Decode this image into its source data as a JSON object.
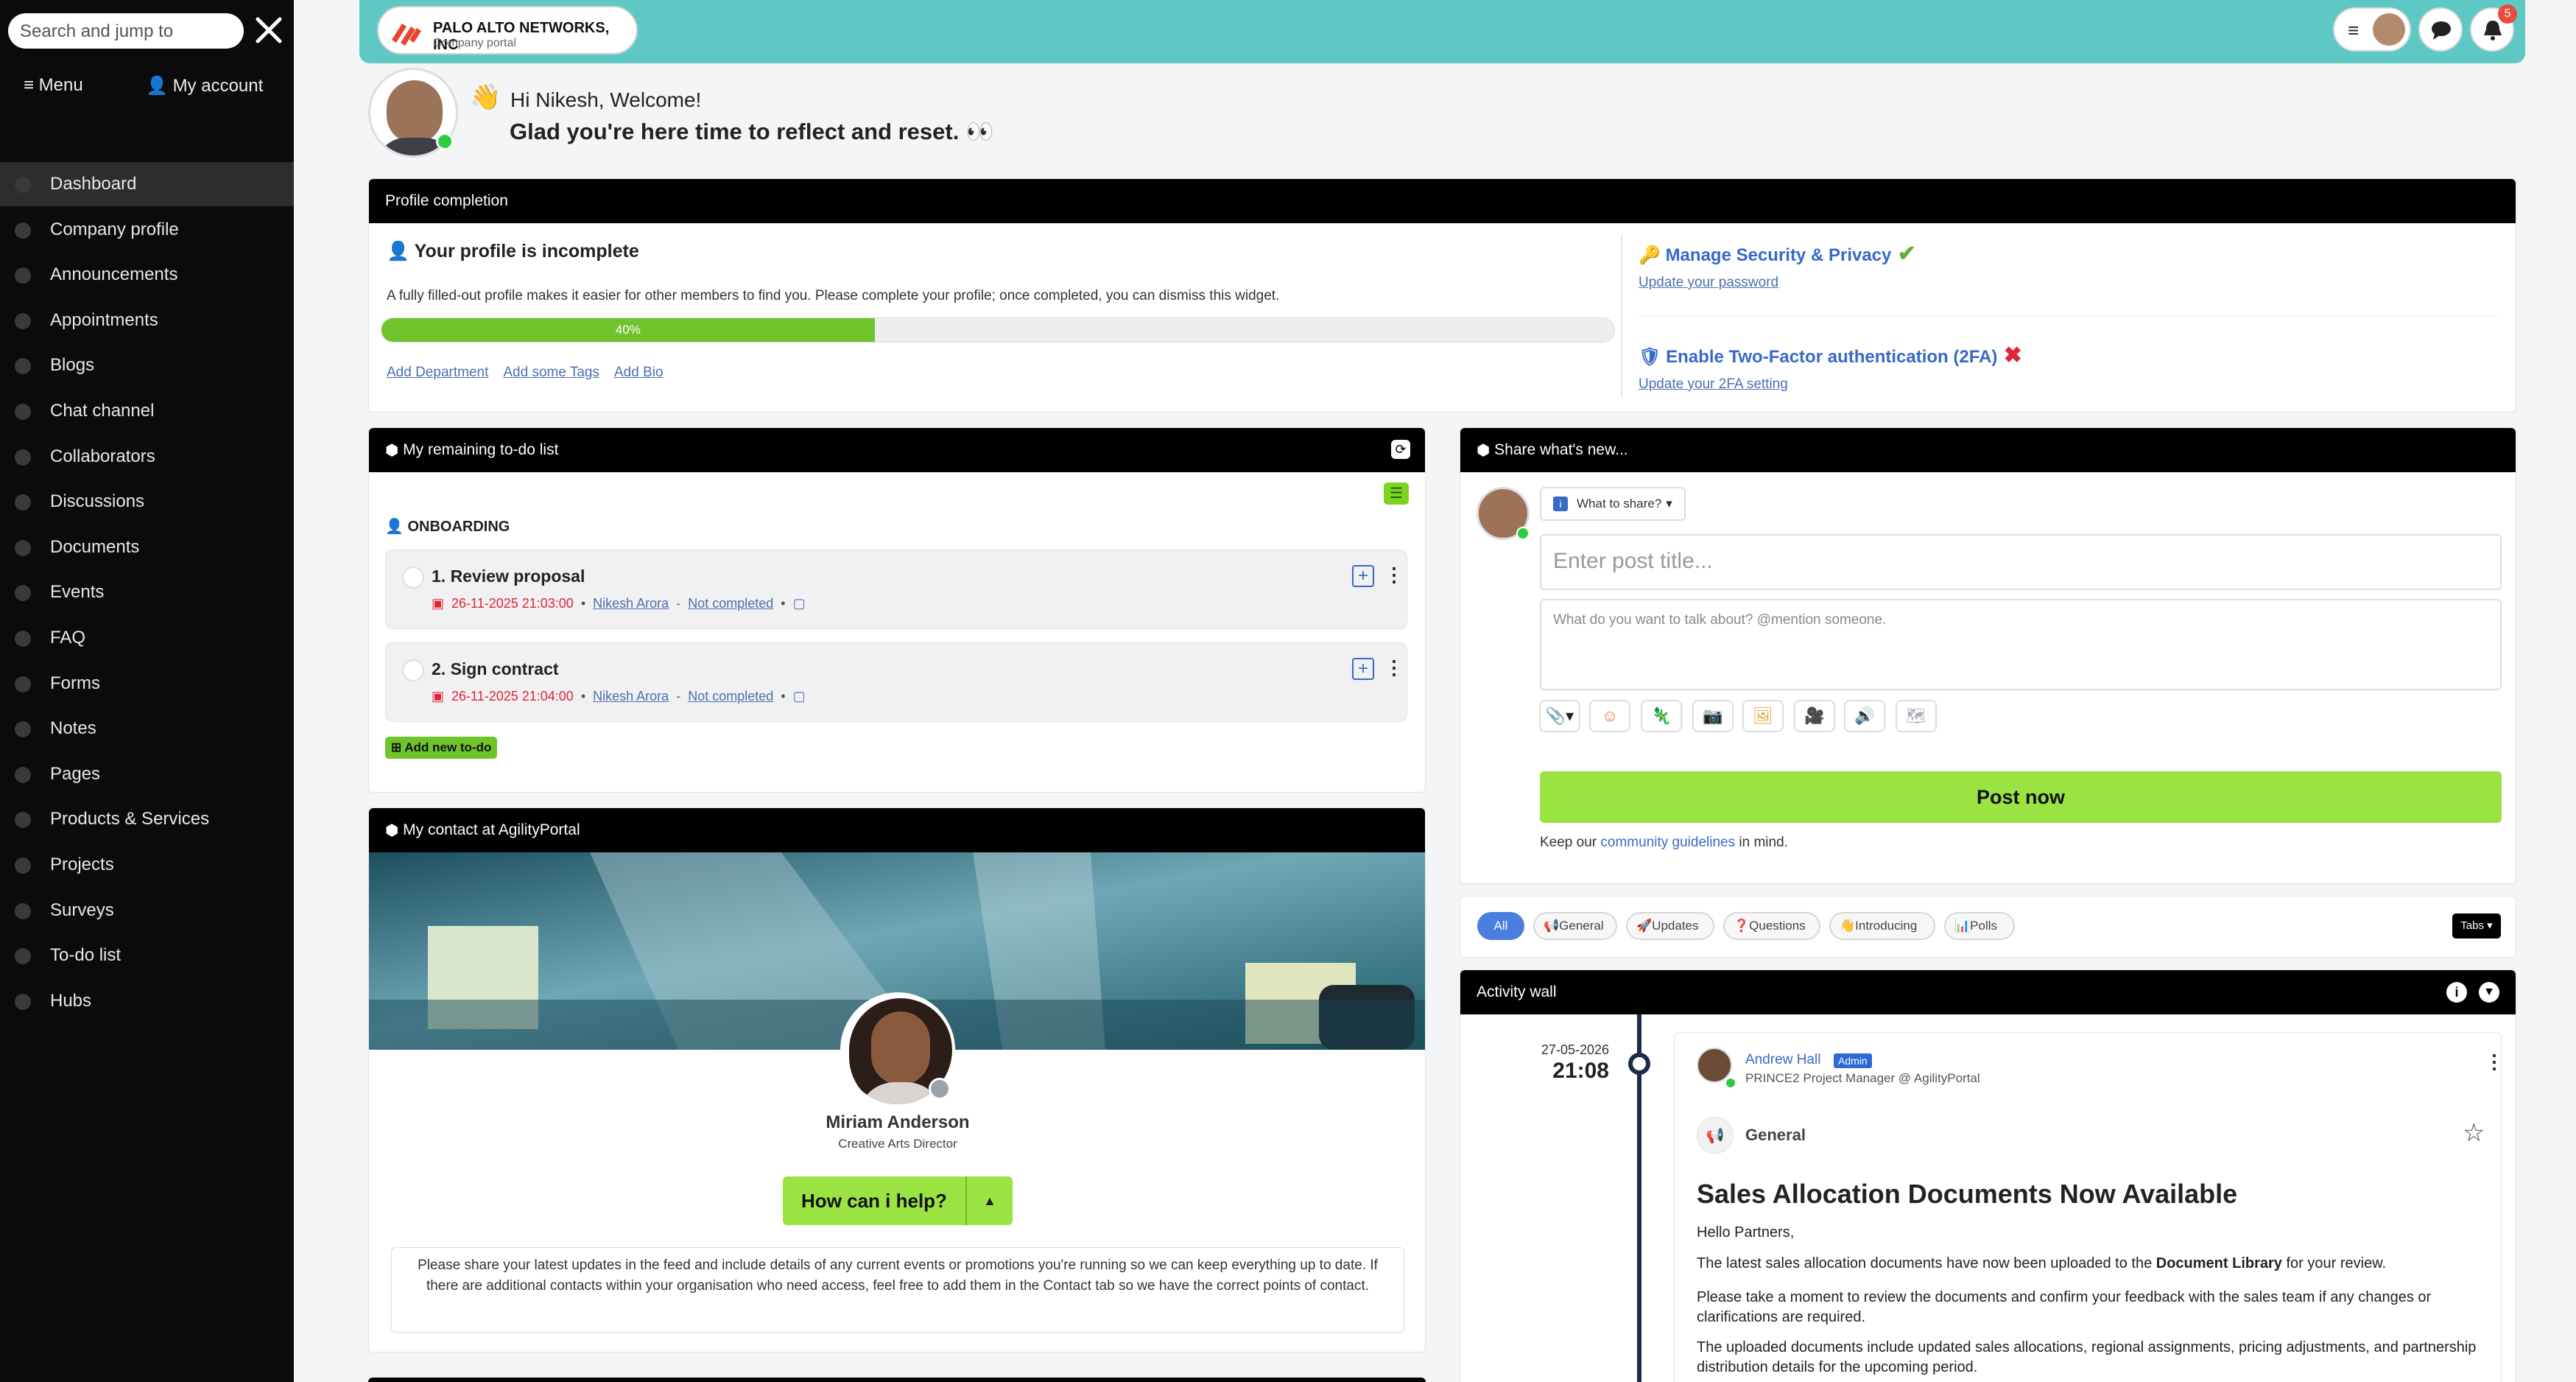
{
  "sidebar": {
    "search_placeholder": "Search and jump to",
    "menu_label": "Menu",
    "account_label": "My account",
    "items": [
      {
        "label": "Dashboard",
        "icon": "home-icon"
      },
      {
        "label": "Company profile",
        "icon": "building-icon"
      },
      {
        "label": "Announcements",
        "icon": "megaphone-icon"
      },
      {
        "label": "Appointments",
        "icon": "calendar-icon"
      },
      {
        "label": "Blogs",
        "icon": "blog-icon"
      },
      {
        "label": "Chat channel",
        "icon": "chat-icon"
      },
      {
        "label": "Collaborators",
        "icon": "users-icon"
      },
      {
        "label": "Discussions",
        "icon": "comments-icon"
      },
      {
        "label": "Documents",
        "icon": "folder-icon"
      },
      {
        "label": "Events",
        "icon": "event-icon"
      },
      {
        "label": "FAQ",
        "icon": "question-icon"
      },
      {
        "label": "Forms",
        "icon": "form-icon"
      },
      {
        "label": "Notes",
        "icon": "note-icon"
      },
      {
        "label": "Pages",
        "icon": "page-icon"
      },
      {
        "label": "Products & Services",
        "icon": "box-icon"
      },
      {
        "label": "Projects",
        "icon": "project-icon"
      },
      {
        "label": "Surveys",
        "icon": "survey-icon"
      },
      {
        "label": "To-do list",
        "icon": "list-icon"
      },
      {
        "label": "Hubs",
        "icon": "hub-icon"
      }
    ]
  },
  "header": {
    "company_name": "PALO ALTO NETWORKS, INC",
    "company_sub": "Company portal",
    "notification_count": "5",
    "accent": "#5ec9c4"
  },
  "welcome": {
    "greeting": "Hi Nikesh, Welcome!",
    "message": "Glad you're here time to reflect and reset. 👀"
  },
  "profile": {
    "header": "Profile completion",
    "title": "Your profile is incomplete",
    "description": "A fully filled-out profile makes it easier for other members to find you. Please complete your profile; once completed, you can dismiss this widget.",
    "progress": 0.4,
    "progress_label": "40%",
    "links": [
      "Add Department",
      "Add some Tags",
      "Add Bio"
    ],
    "security_title": "Manage Security & Privacy",
    "security_link": "Update your password",
    "twofa_title": "Enable Two-Factor authentication (2FA)",
    "twofa_link": "Update your 2FA setting"
  },
  "todo": {
    "header": "My remaining to-do list",
    "group": "ONBOARDING",
    "items": [
      {
        "title": "1. Review proposal",
        "date": "26-11-2025 21:03:00",
        "owner": "Nikesh Arora",
        "status": "Not completed"
      },
      {
        "title": "2. Sign contract",
        "date": "26-11-2025 21:04:00",
        "owner": "Nikesh Arora",
        "status": "Not completed"
      }
    ],
    "add_label": "Add new to-do"
  },
  "contact": {
    "header": "My contact at AgilityPortal",
    "name": "Miriam Anderson",
    "role": "Creative Arts Director",
    "help_label": "How can i help?",
    "note": "Please share your latest updates in the feed and include details of any current events or promotions you're running so we can keep everything up to date. If there are additional contacts within your organisation who need access, feel free to add them in the Contact tab so we have the correct points of contact."
  },
  "share": {
    "header": "Share what's new...",
    "what_label": "What to share?",
    "title_placeholder": "Enter post title...",
    "body_placeholder": "What do you want to talk about? @mention someone.",
    "post_label": "Post now",
    "guidelines_pre": "Keep our",
    "guidelines_link": "community guidelines",
    "guidelines_post": "in mind."
  },
  "filters": {
    "items": [
      "All",
      "General",
      "Updates",
      "Questions",
      "Introducing",
      "Polls"
    ],
    "tabs_label": "Tabs"
  },
  "activity": {
    "header": "Activity wall",
    "date": "27-05-2026",
    "time": "21:08",
    "author": "Andrew Hall",
    "badge": "Admin",
    "author_role": "PRINCE2 Project Manager @ AgilityPortal",
    "category": "General",
    "title": "Sales Allocation Documents Now Available",
    "p1": "Hello Partners,",
    "p2_pre": "The latest sales allocation documents have now been uploaded to the",
    "p2_bold": "Document Library",
    "p2_post": "for your review.",
    "p3": "Please take a moment to review the documents and confirm your feedback with the sales team if any changes or clarifications are required.",
    "p4": "The uploaded documents include updated sales allocations, regional assignments, pricing adjustments, and partnership distribution details for the upcoming period."
  }
}
